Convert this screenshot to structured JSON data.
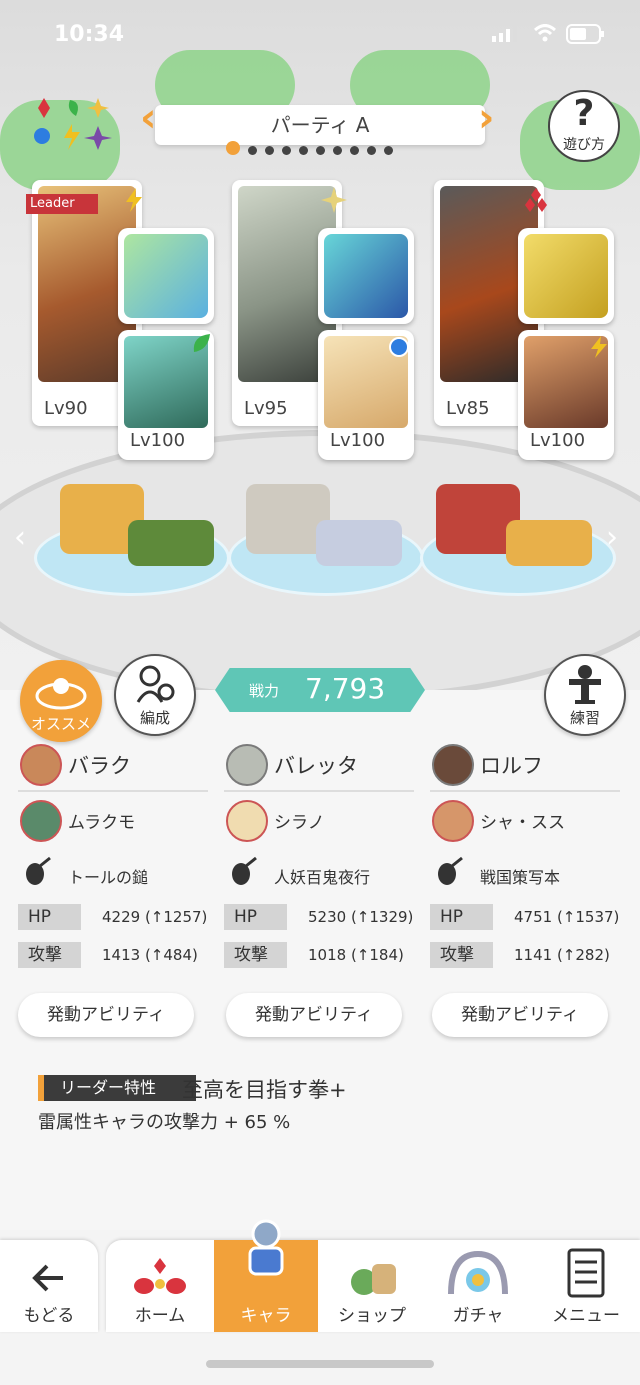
{
  "status_bar": {
    "time": "10:34"
  },
  "party": {
    "title": "パーティ A",
    "page_count": 10,
    "active_page": 1
  },
  "help_button": {
    "label": "遊び方"
  },
  "members": [
    {
      "leader_badge": "Leader",
      "level": "Lv90",
      "support_level": "Lv100",
      "name": "バラク",
      "support": "ムラクモ",
      "weapon": "トールの鎚",
      "hp_label": "HP",
      "hp": "4229 (↑1257)",
      "atk_label": "攻撃",
      "atk": "1413 (↑484)",
      "ability": "発動アビリティ"
    },
    {
      "level": "Lv95",
      "support_level": "Lv100",
      "name": "バレッタ",
      "support": "シラノ",
      "weapon": "人妖百鬼夜行",
      "hp_label": "HP",
      "hp": "5230 (↑1329)",
      "atk_label": "攻撃",
      "atk": "1018 (↑184)",
      "ability": "発動アビリティ"
    },
    {
      "level": "Lv85",
      "support_level": "Lv100",
      "name": "ロルフ",
      "support": "シャ・スス",
      "weapon": "戦国策写本",
      "hp_label": "HP",
      "hp": "4751 (↑1537)",
      "atk_label": "攻撃",
      "atk": "1141 (↑282)",
      "ability": "発動アビリティ"
    }
  ],
  "actions": {
    "recommend": "オススメ",
    "formation": "編成",
    "practice": "練習",
    "power_label": "戦力",
    "power_value": "7,793"
  },
  "leader_skill": {
    "tag": "リーダー特性",
    "name": "至高を目指す拳+",
    "desc": "雷属性キャラの攻撃力 + 65 %"
  },
  "nav": {
    "back": "もどる",
    "home": "ホーム",
    "chara": "キャラ",
    "shop": "ショップ",
    "gacha": "ガチャ",
    "menu": "メニュー"
  },
  "colors": {
    "accent": "#f2a13a",
    "power": "#5fc6b6"
  }
}
